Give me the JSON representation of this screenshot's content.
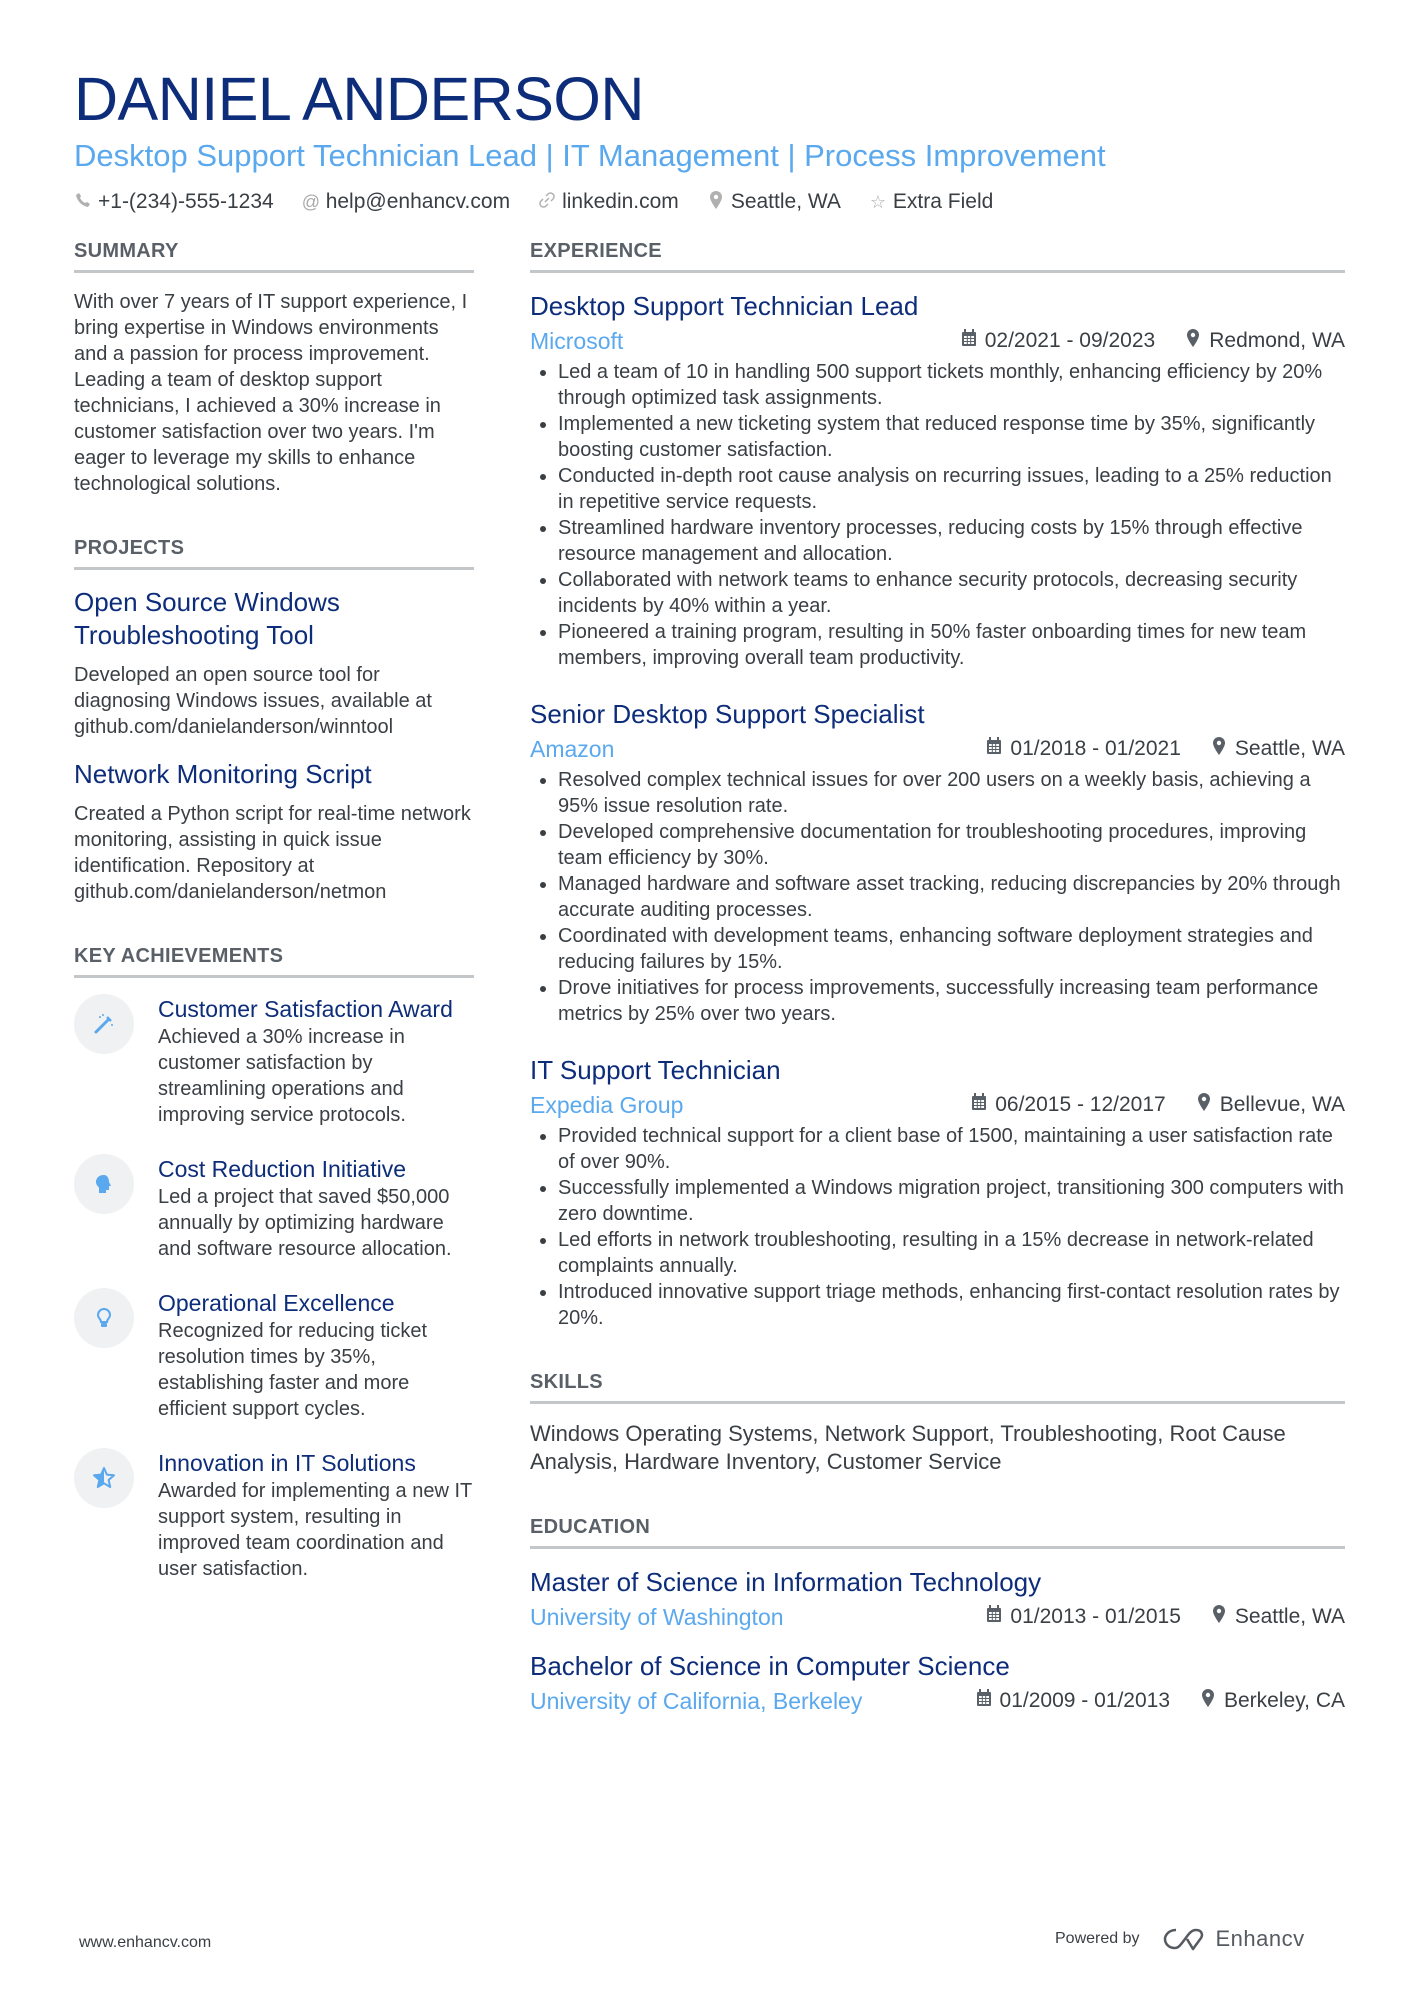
{
  "header": {
    "name": "DANIEL ANDERSON",
    "headline": "Desktop Support Technician Lead | IT Management | Process Improvement",
    "contacts": [
      {
        "icon": "phone-icon",
        "text": "+1-(234)-555-1234"
      },
      {
        "icon": "at-icon",
        "text": "help@enhancv.com"
      },
      {
        "icon": "link-icon",
        "text": "linkedin.com"
      },
      {
        "icon": "location-pin-icon",
        "text": "Seattle, WA"
      },
      {
        "icon": "star-icon",
        "text": "Extra Field"
      }
    ]
  },
  "summary": {
    "title": "SUMMARY",
    "text": "With over 7 years of IT support experience, I bring expertise in Windows environments and a passion for process improvement. Leading a team of desktop support technicians, I achieved a 30% increase in customer satisfaction over two years. I'm eager to leverage my skills to enhance technological solutions."
  },
  "projects": {
    "title": "PROJECTS",
    "items": [
      {
        "title": "Open Source Windows Troubleshooting Tool",
        "description": "Developed an open source tool for diagnosing Windows issues, available at github.com/danielanderson/winntool"
      },
      {
        "title": "Network Monitoring Script",
        "description": "Created a Python script for real-time network monitoring, assisting in quick issue identification. Repository at github.com/danielanderson/netmon"
      }
    ]
  },
  "achievements": {
    "title": "KEY ACHIEVEMENTS",
    "items": [
      {
        "icon": "magic-wand-icon",
        "title": "Customer Satisfaction Award",
        "description": "Achieved a 30% increase in customer satisfaction by streamlining operations and improving service protocols."
      },
      {
        "icon": "head-brain-icon",
        "title": "Cost Reduction Initiative",
        "description": "Led a project that saved $50,000 annually by optimizing hardware and software resource allocation."
      },
      {
        "icon": "lightbulb-icon",
        "title": "Operational Excellence",
        "description": "Recognized for reducing ticket resolution times by 35%, establishing faster and more efficient support cycles."
      },
      {
        "icon": "half-star-icon",
        "title": "Innovation in IT Solutions",
        "description": "Awarded for implementing a new IT support system, resulting in improved team coordination and user satisfaction."
      }
    ]
  },
  "experience": {
    "title": "EXPERIENCE",
    "jobs": [
      {
        "title": "Desktop Support Technician Lead",
        "company": "Microsoft",
        "dates": "02/2021 - 09/2023",
        "location": "Redmond, WA",
        "bullets": [
          "Led a team of 10 in handling 500 support tickets monthly, enhancing efficiency by 20% through optimized task assignments.",
          "Implemented a new ticketing system that reduced response time by 35%, significantly boosting customer satisfaction.",
          "Conducted in-depth root cause analysis on recurring issues, leading to a 25% reduction in repetitive service requests.",
          "Streamlined hardware inventory processes, reducing costs by 15% through effective resource management and allocation.",
          "Collaborated with network teams to enhance security protocols, decreasing security incidents by 40% within a year.",
          "Pioneered a training program, resulting in 50% faster onboarding times for new team members, improving overall team productivity."
        ]
      },
      {
        "title": "Senior Desktop Support Specialist",
        "company": "Amazon",
        "dates": "01/2018 - 01/2021",
        "location": "Seattle, WA",
        "bullets": [
          "Resolved complex technical issues for over 200 users on a weekly basis, achieving a 95% issue resolution rate.",
          "Developed comprehensive documentation for troubleshooting procedures, improving team efficiency by 30%.",
          "Managed hardware and software asset tracking, reducing discrepancies by 20% through accurate auditing processes.",
          "Coordinated with development teams, enhancing software deployment strategies and reducing failures by 15%.",
          "Drove initiatives for process improvements, successfully increasing team performance metrics by 25% over two years."
        ]
      },
      {
        "title": "IT Support Technician",
        "company": "Expedia Group",
        "dates": "06/2015 - 12/2017",
        "location": "Bellevue, WA",
        "bullets": [
          "Provided technical support for a client base of 1500, maintaining a user satisfaction rate of over 90%.",
          "Successfully implemented a Windows migration project, transitioning 300 computers with zero downtime.",
          "Led efforts in network troubleshooting, resulting in a 15% decrease in network-related complaints annually.",
          "Introduced innovative support triage methods, enhancing first-contact resolution rates by 20%."
        ]
      }
    ]
  },
  "skills": {
    "title": "SKILLS",
    "text": "Windows Operating Systems, Network Support, Troubleshooting, Root Cause Analysis, Hardware Inventory, Customer Service"
  },
  "education": {
    "title": "EDUCATION",
    "items": [
      {
        "degree": "Master of Science in Information Technology",
        "school": "University of Washington",
        "dates": "01/2013 - 01/2015",
        "location": "Seattle, WA"
      },
      {
        "degree": "Bachelor of Science in Computer Science",
        "school": "University of California, Berkeley",
        "dates": "01/2009 - 01/2013",
        "location": "Berkeley, CA"
      }
    ]
  },
  "footer": {
    "website": "www.enhancv.com",
    "powered_by": "Powered by",
    "brand": "Enhancv"
  },
  "colors": {
    "primary": "#0d2d7a",
    "accent": "#5aa8ee",
    "text": "#3a3f44",
    "rule": "#c4c7ca",
    "icon_bg": "#f0f1f2"
  }
}
